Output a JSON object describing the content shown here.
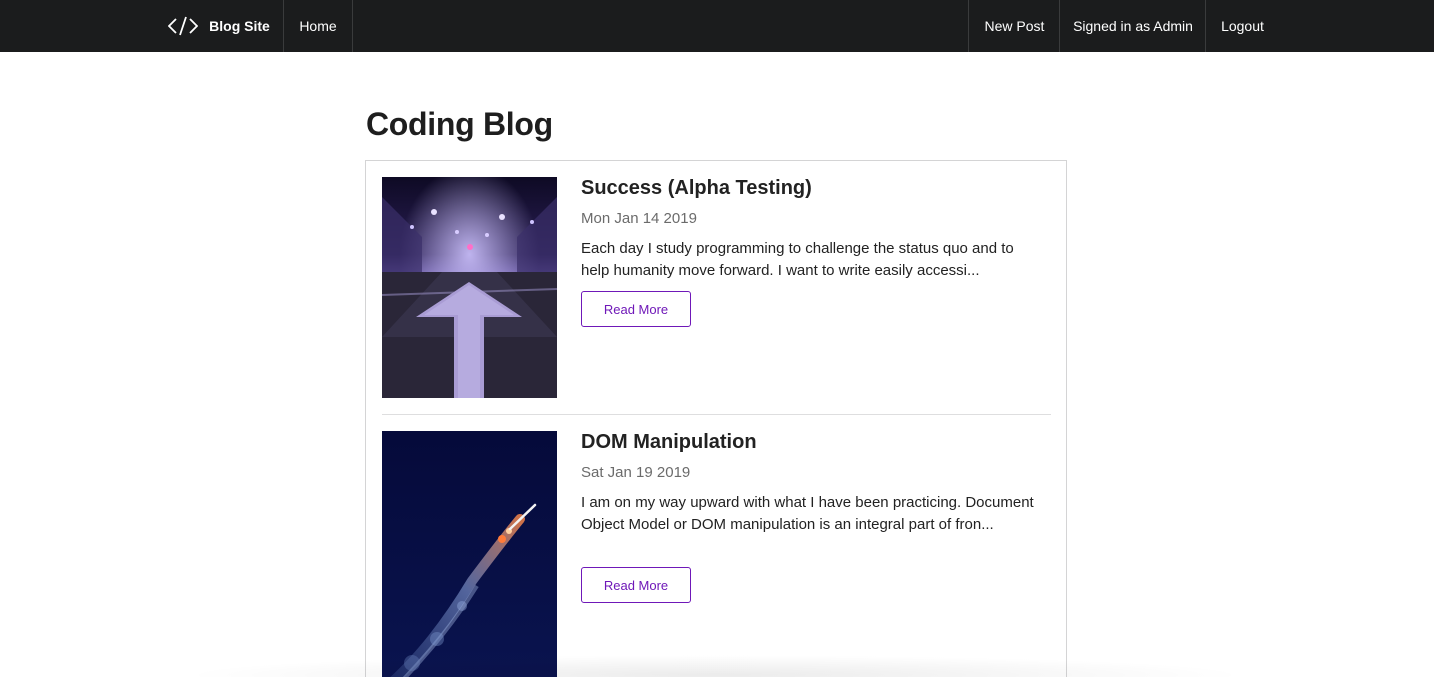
{
  "navbar": {
    "brand_label": "Blog Site",
    "brand_icon": "code-icon",
    "home_label": "Home",
    "new_post_label": "New Post",
    "signed_in_label": "Signed in as Admin",
    "logout_label": "Logout"
  },
  "page": {
    "title": "Coding Blog"
  },
  "posts": [
    {
      "title": "Success (Alpha Testing)",
      "date": "Mon Jan 14 2019",
      "excerpt": "Each day I study programming to challenge the status quo and to help humanity move forward. I want to write easily accessi...",
      "button_label": "Read More",
      "image": "road-arrow-night-photo"
    },
    {
      "title": "DOM Manipulation",
      "date": "Sat Jan 19 2019",
      "excerpt": "I am on my way upward with what I have been practicing. Document Object Model or DOM manipulation is an integral part of fron...",
      "button_label": "Read More",
      "image": "rocket-launch-photo"
    }
  ],
  "colors": {
    "navbar_bg": "#1b1c1d",
    "accent": "#6f18b8"
  }
}
